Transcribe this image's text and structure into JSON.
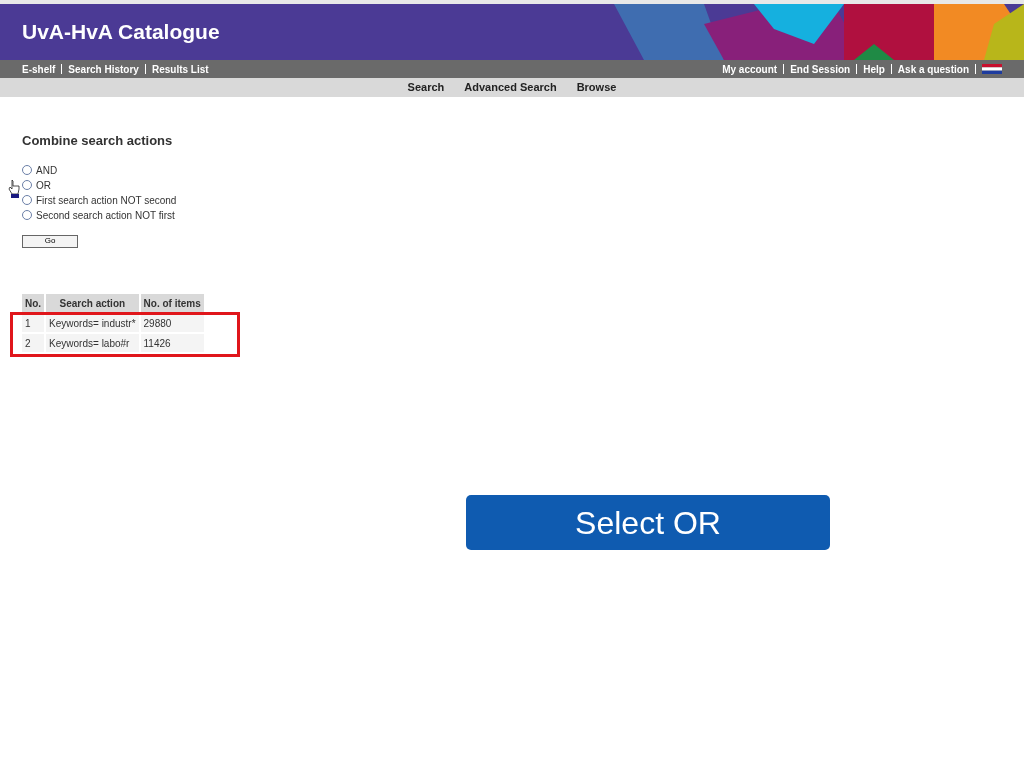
{
  "header": {
    "title": "UvA-HvA Catalogue"
  },
  "left_links": [
    "E-shelf",
    "Search History",
    "Results List"
  ],
  "right_links": [
    "My account",
    "End Session",
    "Help",
    "Ask a question"
  ],
  "nav": [
    "Search",
    "Advanced Search",
    "Browse"
  ],
  "heading": "Combine search actions",
  "options": [
    {
      "label": "AND",
      "selected": false
    },
    {
      "label": "OR",
      "selected": false
    },
    {
      "label": "First search action NOT second",
      "selected": false
    },
    {
      "label": "Second search action NOT first",
      "selected": false
    }
  ],
  "go_button": "Go",
  "table": {
    "columns": [
      "No.",
      "Search action",
      "No. of items"
    ],
    "rows": [
      [
        "1",
        "Keywords= industr*",
        "29880"
      ],
      [
        "2",
        "Keywords= labo#r",
        "11426"
      ]
    ]
  },
  "callout": "Select OR"
}
